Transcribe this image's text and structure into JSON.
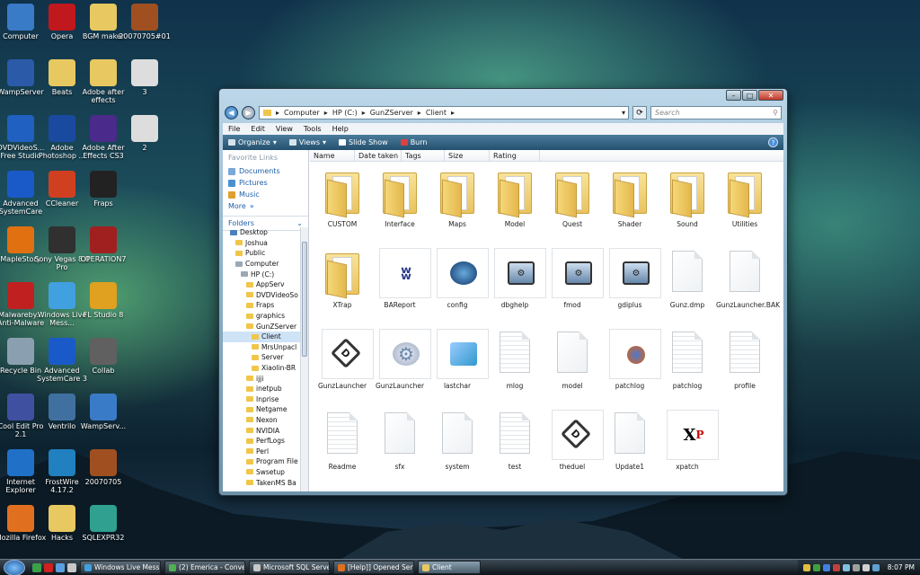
{
  "desktop": {
    "icons": [
      {
        "label": "Computer"
      },
      {
        "label": "Opera"
      },
      {
        "label": "BGM maker"
      },
      {
        "label": "20070705#01"
      },
      {
        "label": "WampServer"
      },
      {
        "label": "Beats"
      },
      {
        "label": "Adobe after effects"
      },
      {
        "label": "3"
      },
      {
        "label": "DVDVideoS... Free Studio"
      },
      {
        "label": "Adobe Photoshop ..."
      },
      {
        "label": "Adobe After Effects CS3"
      },
      {
        "label": "2"
      },
      {
        "label": "Advanced SystemCare"
      },
      {
        "label": "CCleaner"
      },
      {
        "label": "Fraps"
      },
      {
        "label": "MapleStory"
      },
      {
        "label": "Sony Vegas 8.0 Pro"
      },
      {
        "label": "OPERATION7"
      },
      {
        "label": "Malwareby... Anti-Malware"
      },
      {
        "label": "Windows Live Mess..."
      },
      {
        "label": "FL Studio 8"
      },
      {
        "label": "Recycle Bin"
      },
      {
        "label": "Advanced SystemCare 3"
      },
      {
        "label": "Collab"
      },
      {
        "label": "Cool Edit Pro 2.1"
      },
      {
        "label": "Ventrilo"
      },
      {
        "label": "WampServ..."
      },
      {
        "label": "Internet Explorer"
      },
      {
        "label": "FrostWire 4.17.2"
      },
      {
        "label": "20070705"
      },
      {
        "label": "Mozilla Firefox"
      },
      {
        "label": "Hacks"
      },
      {
        "label": "SQLEXPR32"
      }
    ]
  },
  "window": {
    "breadcrumbs": [
      "Computer",
      "HP (C:)",
      "GunZServer",
      "Client"
    ],
    "search_placeholder": "Search",
    "menu": [
      "File",
      "Edit",
      "View",
      "Tools",
      "Help"
    ],
    "commands": [
      "Organize",
      "Views",
      "Slide Show",
      "Burn"
    ],
    "favorites_title": "Favorite Links",
    "favorites": [
      "Documents",
      "Pictures",
      "Music"
    ],
    "more_label": "More",
    "folders_label": "Folders",
    "tree": [
      {
        "label": "Desktop",
        "indent": 1
      },
      {
        "label": "Joshua",
        "indent": 2
      },
      {
        "label": "Public",
        "indent": 2
      },
      {
        "label": "Computer",
        "indent": 2
      },
      {
        "label": "HP (C:)",
        "indent": 3
      },
      {
        "label": "AppServ",
        "indent": 4
      },
      {
        "label": "DVDVideoSo",
        "indent": 4
      },
      {
        "label": "Fraps",
        "indent": 4
      },
      {
        "label": "graphics",
        "indent": 4
      },
      {
        "label": "GunZServer",
        "indent": 4
      },
      {
        "label": "Client",
        "indent": 5,
        "selected": true
      },
      {
        "label": "MrsUnpacl",
        "indent": 5
      },
      {
        "label": "Server",
        "indent": 5
      },
      {
        "label": "Xiaolin-BR",
        "indent": 5
      },
      {
        "label": "ijji",
        "indent": 4
      },
      {
        "label": "inetpub",
        "indent": 4
      },
      {
        "label": "Inprise",
        "indent": 4
      },
      {
        "label": "Netgame",
        "indent": 4
      },
      {
        "label": "Nexon",
        "indent": 4
      },
      {
        "label": "NVIDIA",
        "indent": 4
      },
      {
        "label": "PerfLogs",
        "indent": 4
      },
      {
        "label": "Perl",
        "indent": 4
      },
      {
        "label": "Program File",
        "indent": 4
      },
      {
        "label": "Swsetup",
        "indent": 4
      },
      {
        "label": "TakenMS Ba",
        "indent": 4
      }
    ],
    "columns": [
      "Name",
      "Date taken",
      "Tags",
      "Size",
      "Rating"
    ],
    "items": [
      {
        "label": "CUSTOM",
        "kind": "folder"
      },
      {
        "label": "Interface",
        "kind": "folder"
      },
      {
        "label": "Maps",
        "kind": "folder"
      },
      {
        "label": "Model",
        "kind": "folder"
      },
      {
        "label": "Quest",
        "kind": "folder"
      },
      {
        "label": "Shader",
        "kind": "folder"
      },
      {
        "label": "Sound",
        "kind": "folder"
      },
      {
        "label": "Utilities",
        "kind": "folder"
      },
      {
        "label": "XTrap",
        "kind": "folder"
      },
      {
        "label": "BAReport",
        "kind": "app"
      },
      {
        "label": "config",
        "kind": "xml"
      },
      {
        "label": "dbghelp",
        "kind": "dll"
      },
      {
        "label": "fmod",
        "kind": "dll"
      },
      {
        "label": "gdiplus",
        "kind": "dll"
      },
      {
        "label": "Gunz.dmp",
        "kind": "file"
      },
      {
        "label": "GunzLauncher.BAK",
        "kind": "file"
      },
      {
        "label": "GunzLauncher",
        "kind": "gunz"
      },
      {
        "label": "GunzLauncher",
        "kind": "gear"
      },
      {
        "label": "lastchar",
        "kind": "notepad"
      },
      {
        "label": "mlog",
        "kind": "text"
      },
      {
        "label": "model",
        "kind": "file"
      },
      {
        "label": "patchlog",
        "kind": "firefox"
      },
      {
        "label": "patchlog",
        "kind": "text"
      },
      {
        "label": "profile",
        "kind": "text"
      },
      {
        "label": "Readme",
        "kind": "text"
      },
      {
        "label": "sfx",
        "kind": "file"
      },
      {
        "label": "system",
        "kind": "file"
      },
      {
        "label": "test",
        "kind": "text"
      },
      {
        "label": "theduel",
        "kind": "gunz"
      },
      {
        "label": "Update1",
        "kind": "file"
      },
      {
        "label": "xpatch",
        "kind": "xp"
      }
    ]
  },
  "taskbar": {
    "buttons": [
      {
        "label": "Windows Live Mess..."
      },
      {
        "label": "(2) Emerica - Conve..."
      },
      {
        "label": "Microsoft SQL Serve..."
      },
      {
        "label": "[Help]] Opened Serv..."
      },
      {
        "label": "Client",
        "active": true
      }
    ],
    "clock": "8:07 PM"
  },
  "colors": {
    "accent": "#1f5fa8",
    "folder": "#f0c64a",
    "selection": "#cfe3f6"
  }
}
